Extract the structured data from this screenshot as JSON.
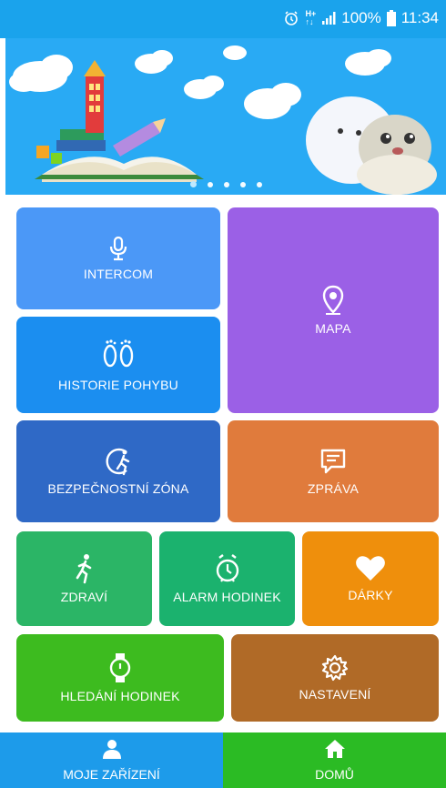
{
  "status_bar": {
    "battery": "100%",
    "time": "11:34"
  },
  "banner": {
    "slide_count": 5,
    "active_slide": 1
  },
  "tiles": {
    "intercom": "INTERCOM",
    "mapa": "MAPA",
    "historie": "HISTORIE POHYBU",
    "zona": "BEZPEČNOSTNÍ ZÓNA",
    "zprava": "ZPRÁVA",
    "zdravi": "ZDRAVÍ",
    "alarm": "ALARM HODINEK",
    "darky": "DÁRKY",
    "hledani": "HLEDÁNÍ HODINEK",
    "nastaveni": "NASTAVENÍ"
  },
  "bottom_nav": {
    "moje": "MOJE ZAŘÍZENÍ",
    "domu": "DOMŮ"
  },
  "colors": {
    "status": "#1aa3ec",
    "intercom": "#4b98f7",
    "mapa": "#9b60e6",
    "historie": "#1b8ef0",
    "zona": "#2f69c6",
    "zprava": "#e07b3c",
    "zdravi": "#2bb566",
    "alarm": "#1bb26e",
    "darky": "#ef8f0c",
    "hledani": "#3dbb1f",
    "nastaveni": "#b06a27",
    "moje": "#1d9bea",
    "domu": "#2bbb24"
  }
}
